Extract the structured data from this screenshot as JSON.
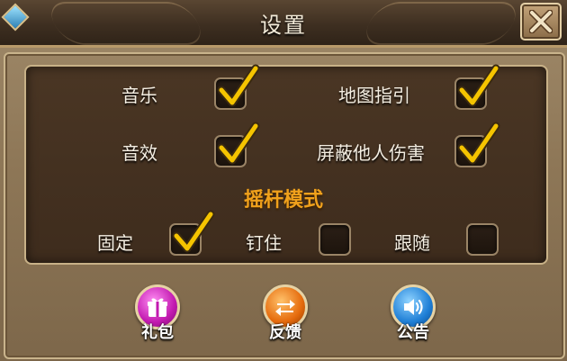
{
  "window": {
    "title": "设置",
    "close_icon": "close-x-icon"
  },
  "options": {
    "music": {
      "label": "音乐",
      "checked": true
    },
    "map_guide": {
      "label": "地图指引",
      "checked": true
    },
    "sound_fx": {
      "label": "音效",
      "checked": true
    },
    "block_damage": {
      "label": "屏蔽他人伤害",
      "checked": true
    }
  },
  "joystick": {
    "title": "摇杆模式",
    "modes": [
      {
        "label": "固定",
        "checked": true
      },
      {
        "label": "钉住",
        "checked": false
      },
      {
        "label": "跟随",
        "checked": false
      }
    ]
  },
  "buttons": {
    "gift": {
      "label": "礼包",
      "icon": "gift-icon",
      "color": "#c21ab0"
    },
    "feedback": {
      "label": "反馈",
      "icon": "swap-arrows-icon",
      "color": "#e56a0c"
    },
    "notice": {
      "label": "公告",
      "icon": "speaker-icon",
      "color": "#1f7fd6"
    }
  },
  "colors": {
    "section_title": "#f0a11c",
    "checkmark": "#f5c400"
  }
}
